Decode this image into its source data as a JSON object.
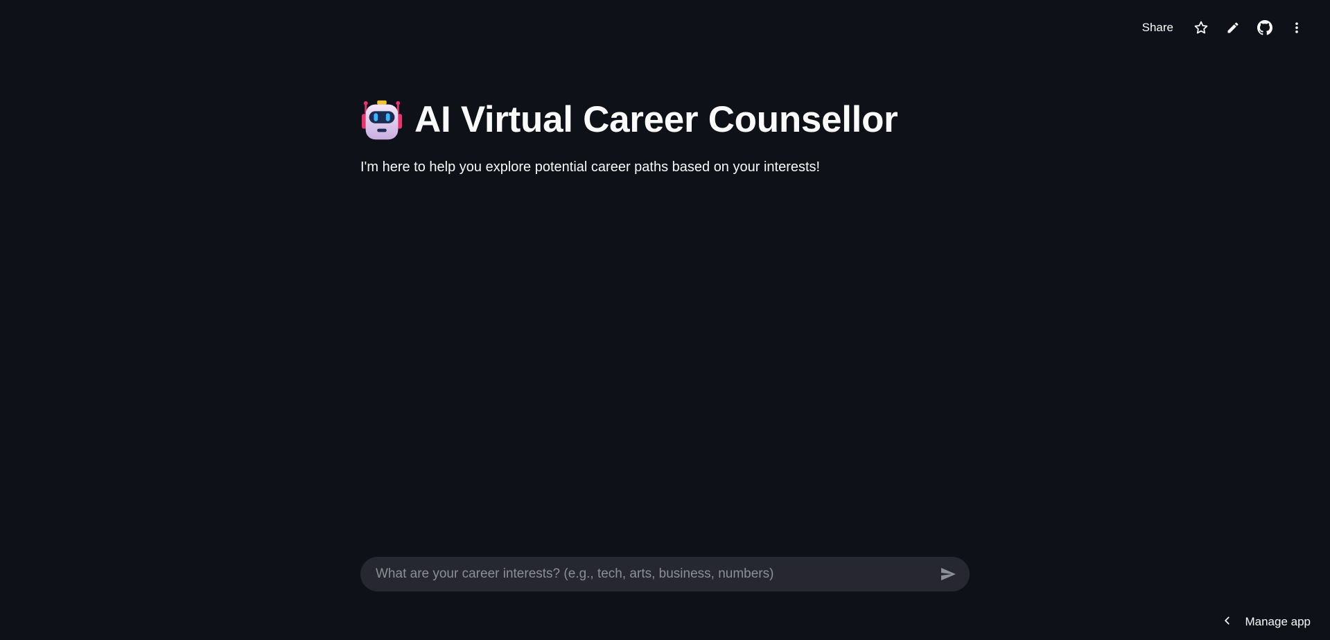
{
  "toolbar": {
    "share_label": "Share",
    "icons": [
      "star-icon",
      "pencil-icon",
      "github-icon",
      "more-vertical-icon"
    ]
  },
  "main": {
    "title_icon": "robot-icon",
    "title": "AI Virtual Career Counsellor",
    "subtitle": "I'm here to help you explore potential career paths based on your interests!"
  },
  "chat": {
    "placeholder": "What are your career interests? (e.g., tech, arts, business, numbers)",
    "value": "",
    "send_icon": "send-icon"
  },
  "footer": {
    "manage_label": "Manage app",
    "manage_icon": "chevron-left-icon"
  },
  "colors": {
    "background": "#0e1117",
    "input_background": "#262730",
    "text": "#fafafa",
    "placeholder": "#8d8f97"
  }
}
